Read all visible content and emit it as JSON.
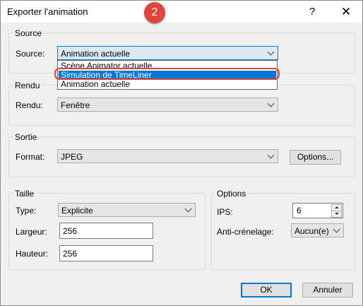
{
  "window": {
    "title": "Exporter l'animation",
    "help_glyph": "?",
    "close_glyph": "✕",
    "step_badge": "2"
  },
  "source": {
    "group_label": "Source",
    "field_label": "Source:",
    "value": "Animation actuelle",
    "options": [
      "Scène Animator actuelle",
      "Simulation de TimeLiner",
      "Animation actuelle"
    ],
    "highlighted_option": "Simulation de TimeLiner"
  },
  "rendu": {
    "group_label": "Rendu",
    "field_label": "Rendu:",
    "value": "Fenêtre"
  },
  "sortie": {
    "group_label": "Sortie",
    "field_label": "Format:",
    "value": "JPEG",
    "options_button": "Options..."
  },
  "taille": {
    "group_label": "Taille",
    "type_label": "Type:",
    "type_value": "Explicite",
    "width_label": "Largeur:",
    "width_value": "256",
    "height_label": "Hauteur:",
    "height_value": "256"
  },
  "options": {
    "group_label": "Options",
    "fps_label": "IPS:",
    "fps_value": "6",
    "aa_label": "Anti-crénelage:",
    "aa_value": "Aucun(e)"
  },
  "footer": {
    "ok_label": "OK",
    "cancel_label": "Annuler"
  },
  "colors": {
    "accent": "#0078d7",
    "annotation_red": "#e0443b",
    "dialog_bg": "#f0f0f0"
  }
}
